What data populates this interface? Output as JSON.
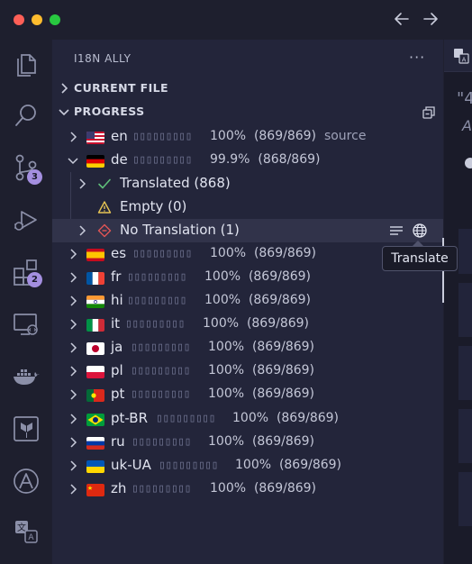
{
  "sidebar": {
    "title": "I18N ALLY",
    "more": "···",
    "sections": {
      "current_file": "CURRENT FILE",
      "progress": "PROGRESS"
    }
  },
  "activity_badges": {
    "source_control": "3",
    "extensions": "2"
  },
  "locales": [
    {
      "code": "en",
      "bar": "▯▯▯▯▯▯▯▯▯",
      "percent": "100%",
      "count": "(869/869)",
      "extra": "source"
    },
    {
      "code": "de",
      "bar": "▯▯▯▯▯▯▯▯▯",
      "percent": "99.9%",
      "count": "(868/869)",
      "extra": ""
    },
    {
      "code": "es",
      "bar": "▯▯▯▯▯▯▯▯▯",
      "percent": "100%",
      "count": "(869/869)",
      "extra": ""
    },
    {
      "code": "fr",
      "bar": "▯▯▯▯▯▯▯▯▯",
      "percent": "100%",
      "count": "(869/869)",
      "extra": ""
    },
    {
      "code": "hi",
      "bar": "▯▯▯▯▯▯▯▯▯",
      "percent": "100%",
      "count": "(869/869)",
      "extra": ""
    },
    {
      "code": "it",
      "bar": "▯▯▯▯▯▯▯▯▯",
      "percent": "100%",
      "count": "(869/869)",
      "extra": ""
    },
    {
      "code": "ja",
      "bar": "▯▯▯▯▯▯▯▯▯",
      "percent": "100%",
      "count": "(869/869)",
      "extra": ""
    },
    {
      "code": "pl",
      "bar": "▯▯▯▯▯▯▯▯▯",
      "percent": "100%",
      "count": "(869/869)",
      "extra": ""
    },
    {
      "code": "pt",
      "bar": "▯▯▯▯▯▯▯▯▯",
      "percent": "100%",
      "count": "(869/869)",
      "extra": ""
    },
    {
      "code": "pt-BR",
      "bar": "▯▯▯▯▯▯▯▯▯",
      "percent": "100%",
      "count": "(869/869)",
      "extra": ""
    },
    {
      "code": "ru",
      "bar": "▯▯▯▯▯▯▯▯▯",
      "percent": "100%",
      "count": "(869/869)",
      "extra": ""
    },
    {
      "code": "uk-UA",
      "bar": "▯▯▯▯▯▯▯▯▯",
      "percent": "100%",
      "count": "(869/869)",
      "extra": ""
    },
    {
      "code": "zh",
      "bar": "▯▯▯▯▯▯▯▯▯",
      "percent": "100%",
      "count": "(869/869)",
      "extra": ""
    }
  ],
  "de_children": {
    "translated": "Translated (868)",
    "empty": "Empty (0)",
    "no_translation": "No Translation (1)"
  },
  "tooltip": "Translate",
  "editor_peek": {
    "quote": "\"4",
    "letter": "A"
  },
  "colors": {
    "accent": "#a48fe0",
    "check": "#5fbf7a",
    "warning": "#e6c454",
    "error": "#e05555"
  }
}
